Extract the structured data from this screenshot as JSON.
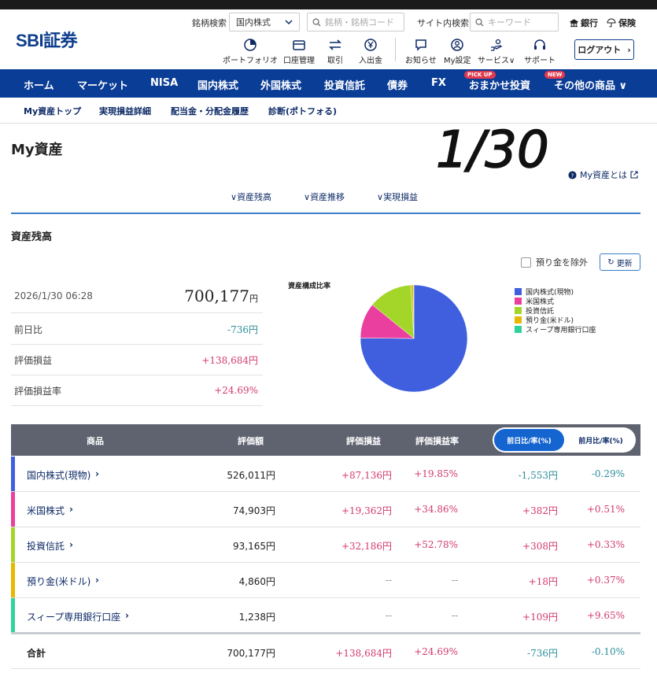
{
  "header": {
    "logo": "SBI証券",
    "stock_search_label": "銘柄検索",
    "stock_search_select": "国内株式",
    "stock_search_placeholder": "銘柄・銘柄コード",
    "site_search_label": "サイト内検索",
    "site_search_placeholder": "キーワード",
    "bank_link": "銀行",
    "insurance_link": "保険",
    "icons": [
      {
        "label": "ポートフォリオ",
        "icon": "portfolio-icon"
      },
      {
        "label": "口座管理",
        "icon": "wallet-icon"
      },
      {
        "label": "取引",
        "icon": "trade-arrows-icon"
      },
      {
        "label": "入出金",
        "icon": "yen-deposit-icon"
      },
      {
        "label": "お知らせ",
        "icon": "chat-icon"
      },
      {
        "label": "My設定",
        "icon": "user-settings-icon"
      },
      {
        "label": "サービス",
        "icon": "service-icon"
      },
      {
        "label": "サポート",
        "icon": "headset-icon"
      }
    ],
    "logout": "ログアウト"
  },
  "nav": {
    "items": [
      "ホーム",
      "マーケット",
      "NISA",
      "国内株式",
      "外国株式",
      "投資信託",
      "債券",
      "FX",
      "おまかせ投資",
      "その他の商品"
    ],
    "badge_pickup": "PICK UP",
    "badge_new": "NEW"
  },
  "subnav": {
    "items": [
      "My資産トップ",
      "実現損益詳細",
      "配当金・分配金履歴",
      "診断(ポトフォる)"
    ]
  },
  "page": {
    "title": "My資産",
    "handwritten": "1/30",
    "about": "My資産とは",
    "anchors": [
      "資産残高",
      "資産推移",
      "実現損益"
    ],
    "section_title": "資産残高",
    "exclude_deposit": "預り金を除外",
    "refresh": "更新"
  },
  "summary": {
    "datetime": "2026/1/30 06:28",
    "total": "700,177",
    "yen": "円",
    "rows": [
      {
        "label": "前日比",
        "value": "-736円"
      },
      {
        "label": "評価損益",
        "value": "+138,684円"
      },
      {
        "label": "評価損益率",
        "value": "+24.69%"
      }
    ]
  },
  "chart_data": {
    "type": "pie",
    "title": "資産構成比率",
    "labels": [
      "国内株式(現物)",
      "米国株式",
      "投資信託",
      "預り金(米ドル)",
      "スィープ専用銀行口座"
    ],
    "values": [
      526011,
      74903,
      93165,
      4860,
      1238
    ],
    "colors": [
      "#3f5fde",
      "#ea3f9f",
      "#a4d62a",
      "#e6b800",
      "#2fd39a"
    ]
  },
  "table": {
    "headers": [
      "商品",
      "評価額",
      "評価損益",
      "評価損益率"
    ],
    "toggle_on": "前日比/率(%)",
    "toggle_off": "前月比/率(%)",
    "rows": [
      {
        "name": "国内株式(現物)",
        "value": "526,011円",
        "pl": "+87,136円",
        "plr": "+19.85%",
        "dd": "-1,553円",
        "ddr": "-0.29%",
        "color": "#3f5fde"
      },
      {
        "name": "米国株式",
        "value": "74,903円",
        "pl": "+19,362円",
        "plr": "+34.86%",
        "dd": "+382円",
        "ddr": "+0.51%",
        "color": "#ea3f9f"
      },
      {
        "name": "投資信託",
        "value": "93,165円",
        "pl": "+32,186円",
        "plr": "+52.78%",
        "dd": "+308円",
        "ddr": "+0.33%",
        "color": "#a4d62a"
      },
      {
        "name": "預り金(米ドル)",
        "value": "4,860円",
        "pl": "--",
        "plr": "--",
        "dd": "+18円",
        "ddr": "+0.37%",
        "color": "#e6b800"
      },
      {
        "name": "スィープ専用銀行口座",
        "value": "1,238円",
        "pl": "--",
        "plr": "--",
        "dd": "+109円",
        "ddr": "+9.65%",
        "color": "#2fd39a"
      }
    ],
    "total": {
      "name": "合計",
      "value": "700,177円",
      "pl": "+138,684円",
      "plr": "+24.69%",
      "dd": "-736円",
      "ddr": "-0.10%"
    }
  }
}
